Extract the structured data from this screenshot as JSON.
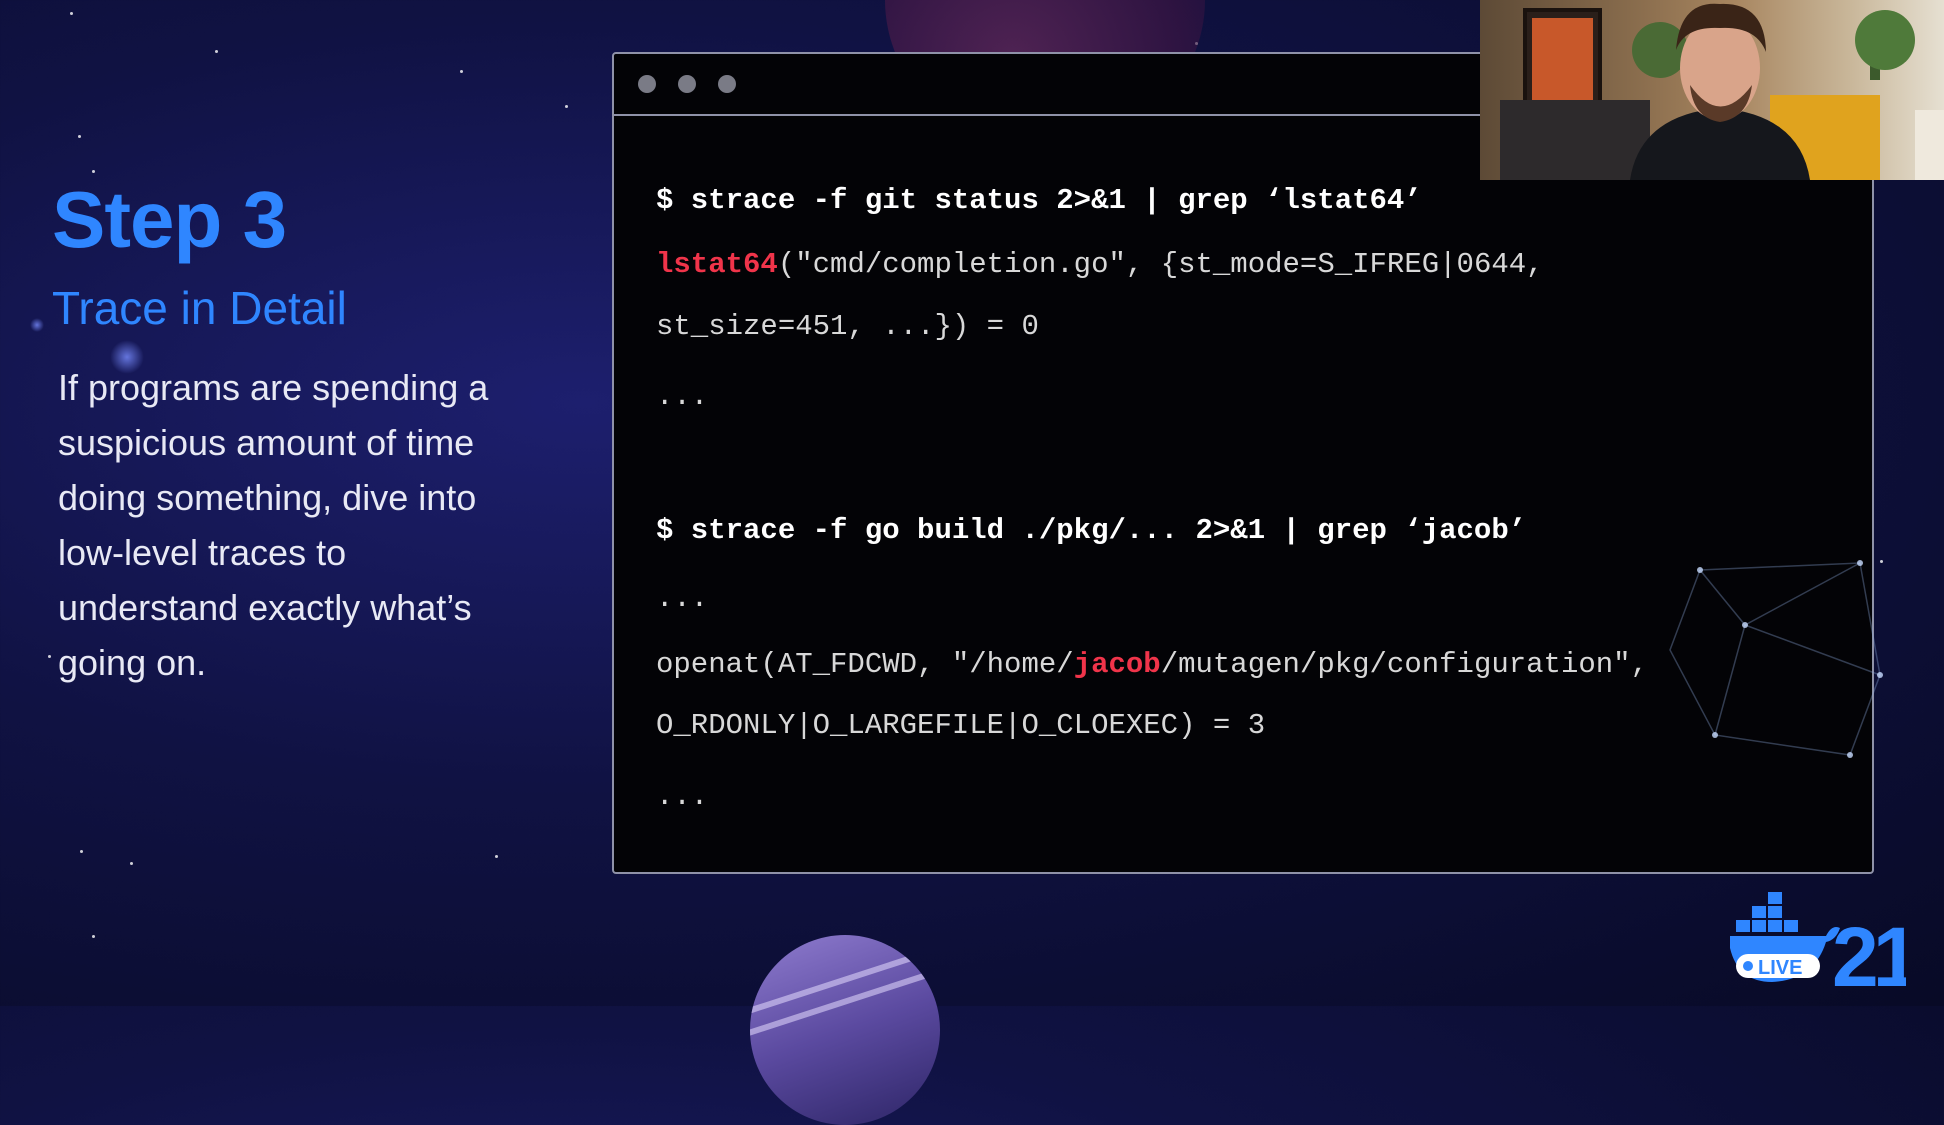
{
  "slide": {
    "title": "Step 3",
    "subtitle": "Trace in Detail",
    "description": "If programs are spending a suspicious amount of time doing something, dive into low-level traces to understand exactly what’s going on."
  },
  "terminal": {
    "lines": [
      {
        "pre": "$ strace -f git status 2>&1 | grep ‘lstat64’",
        "hl": "",
        "post": "",
        "kind": "cmd"
      },
      {
        "pre": "",
        "hl": "lstat64",
        "post": "(\"cmd/completion.go\", {st_mode=S_IFREG|0644,",
        "kind": "out"
      },
      {
        "pre": "st_size=451, ...}) = 0",
        "hl": "",
        "post": "",
        "kind": "out"
      },
      {
        "pre": "...",
        "hl": "",
        "post": "",
        "kind": "out"
      },
      {
        "pre": "$ strace -f go build ./pkg/... 2>&1 | grep ‘jacob’",
        "hl": "",
        "post": "",
        "kind": "cmd"
      },
      {
        "pre": "...",
        "hl": "",
        "post": "",
        "kind": "out"
      },
      {
        "pre": "openat(AT_FDCWD, \"/home/",
        "hl": "jacob",
        "post": "/mutagen/pkg/configuration\",",
        "kind": "out"
      },
      {
        "pre": "O_RDONLY|O_LARGEFILE|O_CLOEXEC) = 3",
        "hl": "",
        "post": "",
        "kind": "out"
      },
      {
        "pre": "...",
        "hl": "",
        "post": "",
        "kind": "out"
      }
    ]
  },
  "logo": {
    "badge": "LIVE",
    "year": "21"
  },
  "colors": {
    "accent": "#2f86ff",
    "highlight": "#f0344a",
    "terminal_bg": "#030306"
  }
}
